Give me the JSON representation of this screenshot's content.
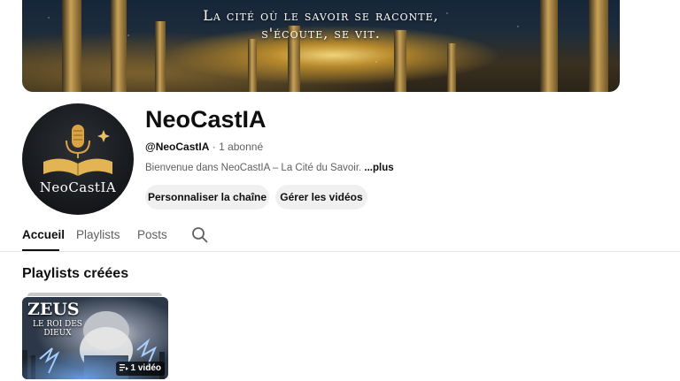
{
  "banner": {
    "line1": "La cité où le savoir se raconte,",
    "line2": "s'écoute, se vit."
  },
  "avatar": {
    "logo_text": "NeoCastIA"
  },
  "channel": {
    "name": "NeoCastIA",
    "handle": "@NeoCastIA",
    "separator": " · ",
    "subscribers": "1 abonné",
    "description": "Bienvenue dans NeoCastIA – La Cité du Savoir. ",
    "more_label": "...plus"
  },
  "buttons": {
    "customize": "Personnaliser la chaîne",
    "manage_videos": "Gérer les vidéos"
  },
  "tabs": [
    {
      "label": "Accueil",
      "active": true
    },
    {
      "label": "Playlists",
      "active": false
    },
    {
      "label": "Posts",
      "active": false
    }
  ],
  "section": {
    "title": "Playlists créées"
  },
  "playlist": {
    "thumb_title": "ZEUS",
    "thumb_subtitle": "LE ROI DES DIEUX",
    "count": "1 vidéo"
  },
  "colors": {
    "text_primary": "#0f0f0f",
    "text_secondary": "#606060",
    "button_bg": "#f0f0f0",
    "divider": "#e5e5e5"
  },
  "icons": {
    "search": "search-icon",
    "playlist": "playlist-icon",
    "microphone": "microphone-icon",
    "book": "book-icon"
  }
}
